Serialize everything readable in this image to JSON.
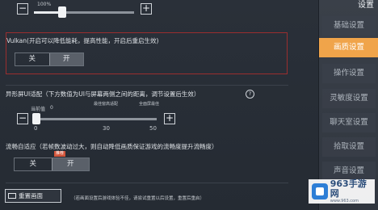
{
  "brightness": {
    "value_label": "100%",
    "level_fraction": 0.2
  },
  "sidebar": {
    "title": "设置",
    "items": [
      {
        "label": "基础设置"
      },
      {
        "label": "画质设置",
        "active": true
      },
      {
        "label": "操作设置"
      },
      {
        "label": "灵敏度设置"
      },
      {
        "label": "聊天室设置"
      },
      {
        "label": "拾取设置"
      },
      {
        "label": "声音设置"
      }
    ]
  },
  "vulkan": {
    "title": "Vulkan(开启可以降低能耗，提高性能，开启后重启生效)",
    "off_label": "关",
    "on_label": "开",
    "selected": "开"
  },
  "screen_adapt": {
    "title": "异形屏UI适配（下方数值为UI与屏幕两侧之间的距离，调节设置后生效）",
    "current_label": "当前值",
    "current_value": "0",
    "hint_left": "最佳窗高适配",
    "hint_right": "全面屏最佳",
    "ticks": [
      "0",
      "30",
      "50"
    ],
    "value": 0
  },
  "fluency": {
    "title": "流畅自适应（若帧数波动过大，则自动降低画质保证游戏的流畅度提升流畅度）",
    "off_label": "关",
    "on_label": "开",
    "badge": "推荐",
    "selected": "开"
  },
  "footer": {
    "reset_label": "重置画面",
    "note": "（若画面设置后游戏体验不佳，请尝试重置以后设置，重置后重启）"
  },
  "watermark": {
    "brand": "963手游网",
    "url": "www.963.com"
  }
}
